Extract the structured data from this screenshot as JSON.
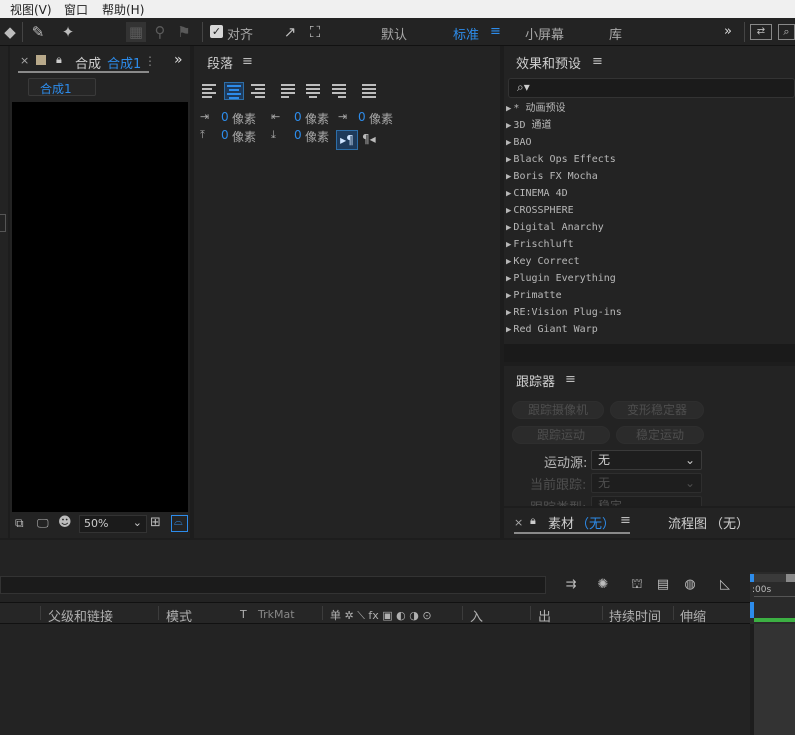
{
  "menu": {
    "view": "视图(V)",
    "window": "窗口",
    "help": "帮助(H)"
  },
  "toolbar": {
    "align_label": "对齐",
    "workspaces": [
      "默认",
      "标准",
      "小屏幕",
      "库"
    ],
    "active_workspace": "标准",
    "more": "»"
  },
  "composition": {
    "tab_prefix": "合成",
    "tab_name": "合成1",
    "tab_menu": "⋮",
    "more": "»",
    "sub_tab": "合成1",
    "zoom": "50%"
  },
  "paragraph": {
    "title": "段落",
    "unit": "像素",
    "indent_left": "0",
    "indent_right": "0",
    "indent_first": "0",
    "space_before": "0",
    "space_after": "0"
  },
  "effects": {
    "title": "效果和预设",
    "search_placeholder": "",
    "items": [
      "* 动画预设",
      "3D 通道",
      "BAO",
      "Black Ops Effects",
      "Boris FX Mocha",
      "CINEMA 4D",
      "CROSSPHERE",
      "Digital Anarchy",
      "Frischluft",
      "Key Correct",
      "Plugin Everything",
      "Primatte",
      "RE:Vision Plug-ins",
      "Red Giant Warp"
    ]
  },
  "tracker": {
    "title": "跟踪器",
    "buttons": [
      "跟踪摄像机",
      "变形稳定器",
      "跟踪运动",
      "稳定运动"
    ],
    "motion_source_label": "运动源:",
    "motion_source_value": "无",
    "current_track_label": "当前跟踪:",
    "current_track_value": "无",
    "track_type_label": "跟踪类型:",
    "track_type_value": "稳定"
  },
  "material": {
    "tab_label": "素材",
    "tab_value": "（无）",
    "flow_label": "流程图",
    "flow_value": "（无）"
  },
  "timeline": {
    "columns": {
      "parent": "父级和链接",
      "mode": "模式",
      "t": "T",
      "trkmat": "TrkMat",
      "switches": "单 ✲ ⟍ fx ▣ ◐ ◑ ⊙",
      "in": "入",
      "out": "出",
      "duration": "持续时间",
      "stretch": "伸缩"
    },
    "time_start": ":00s"
  }
}
